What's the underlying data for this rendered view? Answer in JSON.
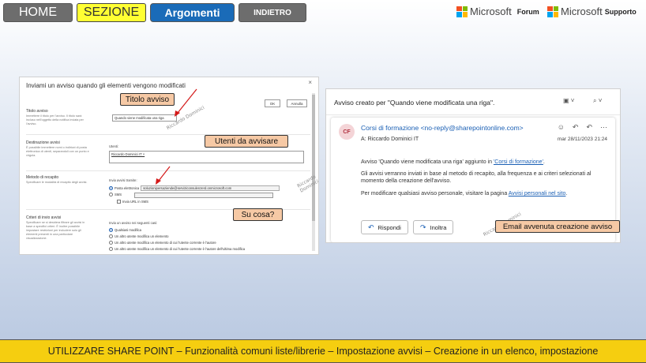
{
  "nav": {
    "home": "HOME",
    "sezione": "SEZIONE",
    "argomenti": "Argomenti",
    "indietro": "INDIETRO"
  },
  "ms_links": [
    {
      "brand": "Microsoft",
      "sub": "Forum"
    },
    {
      "brand": "Microsoft",
      "sub": "Supporto"
    }
  ],
  "ms_colors": [
    "#f25022",
    "#7fba00",
    "#00a4ef",
    "#ffb900"
  ],
  "left_panel": {
    "title": "Inviami un avviso quando gli elementi vengono modificati",
    "close": "×",
    "ok": "OK",
    "annulla": "Annulla",
    "sections": {
      "titolo": {
        "label": "Titolo avviso",
        "desc": "Immettere il titolo per l'avviso. Il titolo sarà incluso nell'oggetto della notifica inviata per l'avviso.",
        "value": "Quando viene modificata una riga"
      },
      "destinazione": {
        "label": "Destinazione avvisi",
        "desc": "È possibile immettere nomi o indirizzi di posta elettronica di utenti, separandoli con un punto e virgola.",
        "field_label": "Utenti:",
        "value": "Riccardo Dominici IT ×"
      },
      "recapito": {
        "label": "Metodo di recapito",
        "desc": "Specificare le modalità di recapito degli avvisi.",
        "field_label": "Invia avvisi tramite:",
        "email_option": "Posta elettronica",
        "email_value": "soluzionipersaziende@serviziconsulenzerd.onmicrosoft.com",
        "sms": "SMS",
        "invia_url": "Invia URL in SMS"
      },
      "criteri": {
        "label": "Criteri di invio avvisi",
        "desc": "Specificare se si desidera filtrare gli avvisi in base a specifici criteri. È inoltre possibile impostare restrizioni per includere solo gli elementi presenti in una particolare visualizzazione.",
        "field_label": "Invia un avviso nei seguenti casi:",
        "options": [
          "Qualsiasi modifica",
          "Un altro utente modifica un elemento",
          "Un altro utente modifica un elemento di cui l'utente corrente è l'autore",
          "Un altro utente modifica un elemento di cui l'utente corrente è l'autore dell'ultima modifica"
        ]
      }
    },
    "callouts": {
      "titolo": "Titolo avviso",
      "utenti": "Utenti da avvisare",
      "cosa": "Su cosa?"
    },
    "watermark": "Riccardo Dominici"
  },
  "right_panel": {
    "subject": "Avviso creato per \"Quando viene modificata una riga\".",
    "avatar": "CF",
    "from": "Corsi di formazione <no-reply@sharepointonline.com>",
    "to_label": "A:",
    "to": "Riccardo Dominici IT",
    "date": "mar 28/11/2023 21:24",
    "body1_pre": "Avviso 'Quando viene modificata una riga' aggiunto in ",
    "body1_link": "'Corsi di formazione'",
    "body1_post": ".",
    "body2": "Gli avvisi verranno inviati in base al metodo di recapito, alla frequenza e ai criteri selezionati al momento della creazione dell'avviso.",
    "body3_pre": "Per modificare qualsiasi avviso personale, visitare la pagina ",
    "body3_link": "Avvisi personali nel sito",
    "body3_post": ".",
    "rispondi": "Rispondi",
    "inoltra": "Inoltra",
    "callout": "Email avvenuta creazione avviso",
    "watermark": "Riccardo Dominici"
  },
  "banner": "UTILIZZARE SHARE POINT – Funzionalità comuni liste/librerie – Impostazione avvisi – Creazione in un elenco, impostazione"
}
